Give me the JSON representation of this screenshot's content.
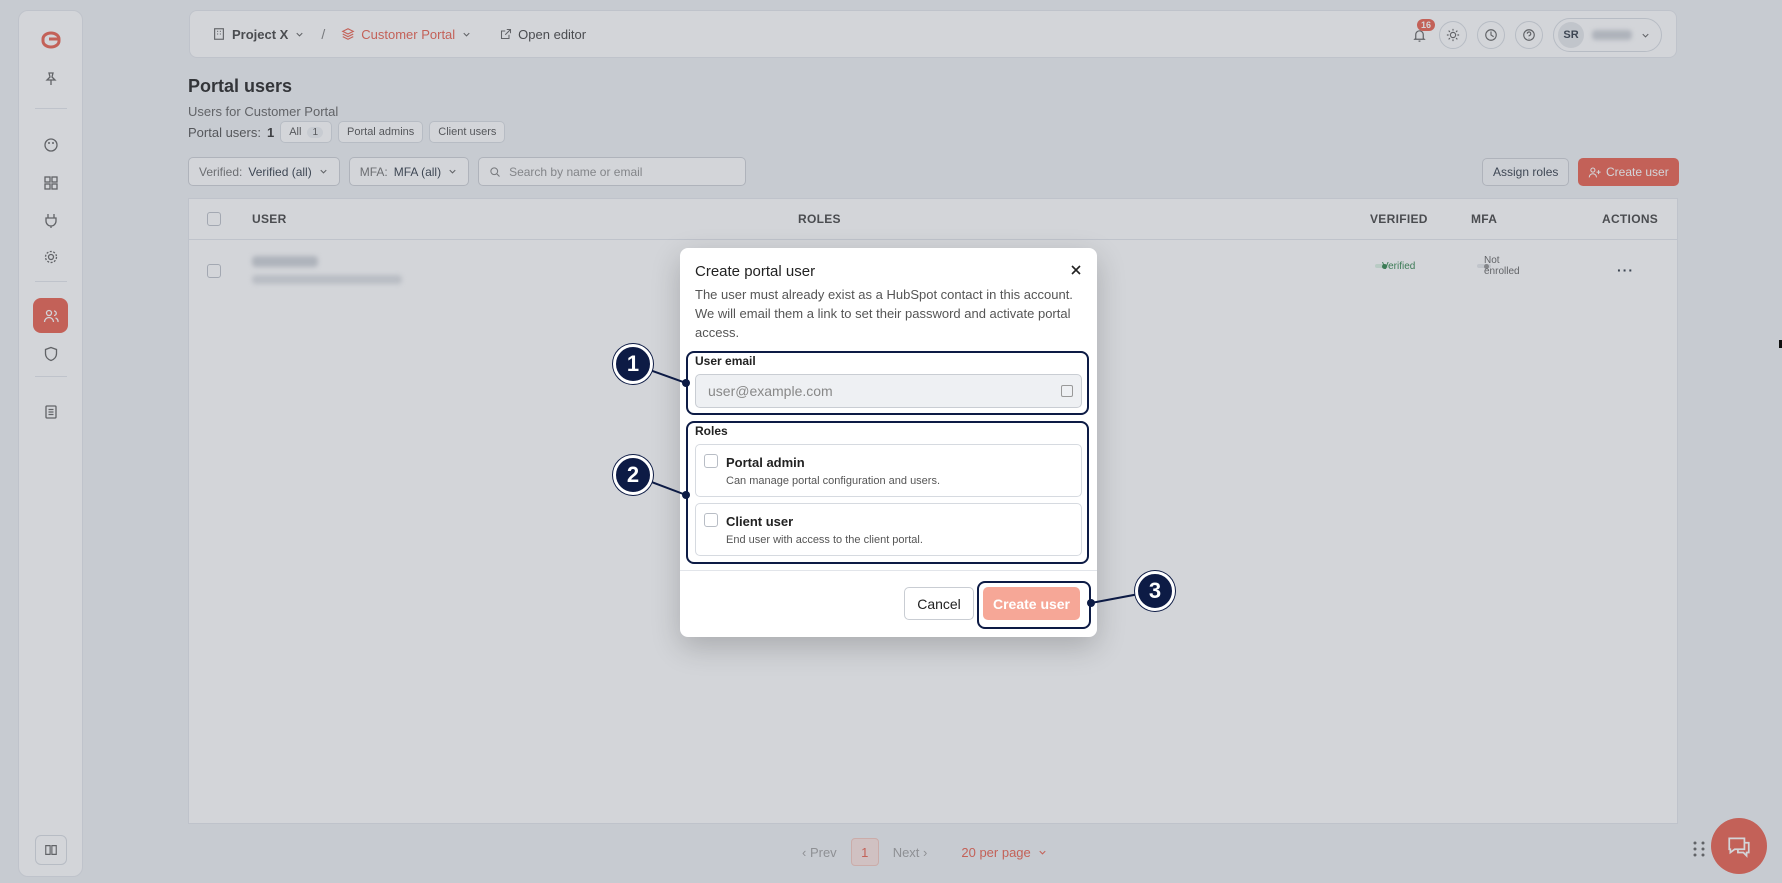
{
  "topbar": {
    "project": "Project X",
    "separator": "/",
    "portal": "Customer Portal",
    "open_editor": "Open editor",
    "notifications_count": "16",
    "user_initials": "SR"
  },
  "page": {
    "title": "Portal users",
    "subtitle": "Users for Customer Portal",
    "count_label": "Portal users:",
    "count_value": "1",
    "chips": [
      {
        "label": "All",
        "count": "1"
      },
      {
        "label": "Portal admins"
      },
      {
        "label": "Client users"
      }
    ]
  },
  "filters": {
    "verified_label": "Verified:",
    "verified_value": "Verified (all)",
    "mfa_label": "MFA:",
    "mfa_value": "MFA (all)",
    "search_placeholder": "Search by name or email"
  },
  "actions": {
    "assign_roles": "Assign roles",
    "create_user": "Create user"
  },
  "table": {
    "columns": [
      "USER",
      "ROLES",
      "VERIFIED",
      "MFA",
      "ACTIONS"
    ],
    "rows": [
      {
        "verified": "Verified",
        "mfa": "Not enrolled",
        "actions": "···"
      }
    ]
  },
  "pagination": {
    "prev": "Prev",
    "current": "1",
    "next": "Next",
    "per_page": "20 per page"
  },
  "modal": {
    "title": "Create portal user",
    "description": "The user must already exist as a HubSpot contact in this account. We will email them a link to set their password and activate portal access.",
    "email_label": "User email",
    "email_placeholder": "user@example.com",
    "roles_label": "Roles",
    "roles": [
      {
        "title": "Portal admin",
        "desc": "Can manage portal configuration and users."
      },
      {
        "title": "Client user",
        "desc": "End user with access to the client portal."
      }
    ],
    "cancel": "Cancel",
    "create": "Create user"
  },
  "callouts": [
    "1",
    "2",
    "3"
  ],
  "colors": {
    "accent": "#e8533f",
    "callout": "#0d1b45",
    "verified_bg": "#d8f0e0",
    "disabled_button": "#f6a797"
  }
}
